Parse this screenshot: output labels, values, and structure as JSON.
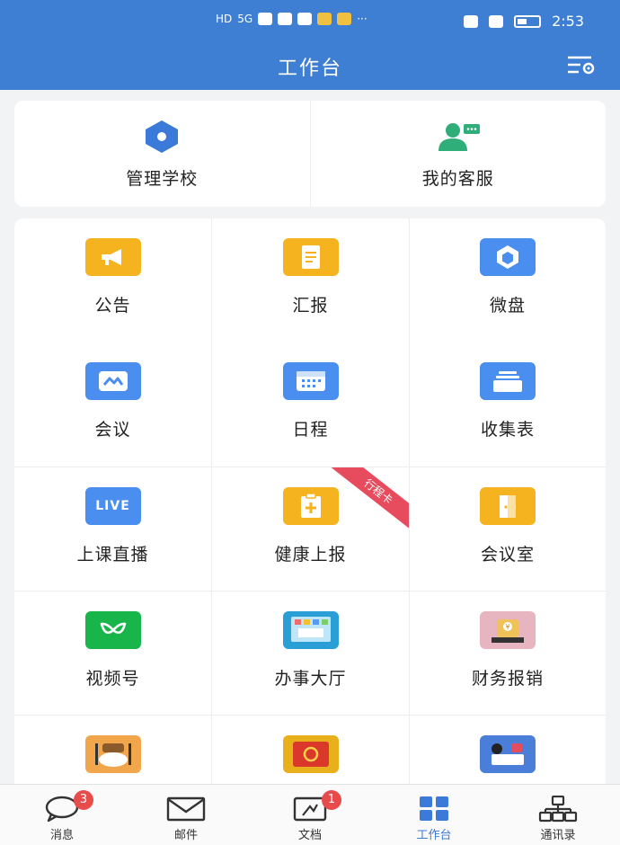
{
  "status_bar": {
    "left_indicators": [
      "HD",
      "5G",
      "wechat",
      "qq",
      "cloud",
      "weibo",
      "mail",
      "more"
    ],
    "time": "2:53"
  },
  "header": {
    "title": "工作台"
  },
  "top_actions": [
    {
      "label": "管理学校",
      "icon": "hexagon-icon",
      "color": "#3b7ad8"
    },
    {
      "label": "我的客服",
      "icon": "customer-service-icon",
      "color": "#2fae79"
    }
  ],
  "apps": [
    {
      "label": "公告",
      "icon": "megaphone-icon",
      "color": "#f5b31f"
    },
    {
      "label": "汇报",
      "icon": "report-icon",
      "color": "#f5b31f"
    },
    {
      "label": "微盘",
      "icon": "cloud-disk-icon",
      "color": "#4a8ef0"
    },
    {
      "label": "会议",
      "icon": "meeting-icon",
      "color": "#4a8ef0"
    },
    {
      "label": "日程",
      "icon": "calendar-icon",
      "color": "#4a8ef0"
    },
    {
      "label": "收集表",
      "icon": "form-icon",
      "color": "#4a8ef0"
    },
    {
      "label": "上课直播",
      "icon": "live-icon",
      "color": "#4a8ef0",
      "icon_text": "LIVE"
    },
    {
      "label": "健康上报",
      "icon": "health-report-icon",
      "color": "#f5b31f",
      "ribbon": "行程卡"
    },
    {
      "label": "会议室",
      "icon": "meeting-room-icon",
      "color": "#f5b31f"
    },
    {
      "label": "视频号",
      "icon": "channels-icon",
      "color": "#17b54a"
    },
    {
      "label": "办事大厅",
      "icon": "service-hall-icon",
      "color": "#2a9fd6"
    },
    {
      "label": "财务报销",
      "icon": "finance-icon",
      "color": "#e7b5c0"
    },
    {
      "label": "",
      "icon": "cafeteria-icon",
      "color": "#f2a64b"
    },
    {
      "label": "",
      "icon": "party-icon",
      "color": "#e8b11c"
    },
    {
      "label": "",
      "icon": "repair-icon",
      "color": "#4a7ed8"
    }
  ],
  "tabbar": [
    {
      "label": "消息",
      "icon": "message-icon",
      "badge": "3"
    },
    {
      "label": "邮件",
      "icon": "mail-icon"
    },
    {
      "label": "文档",
      "icon": "document-icon",
      "badge": "1"
    },
    {
      "label": "工作台",
      "icon": "workbench-icon",
      "active": true
    },
    {
      "label": "通讯录",
      "icon": "contacts-icon"
    }
  ],
  "colors": {
    "header": "#3f7fd3",
    "active_tab": "#3b7ad8",
    "badge": "#e84b4b",
    "ribbon": "#e74c5e"
  }
}
